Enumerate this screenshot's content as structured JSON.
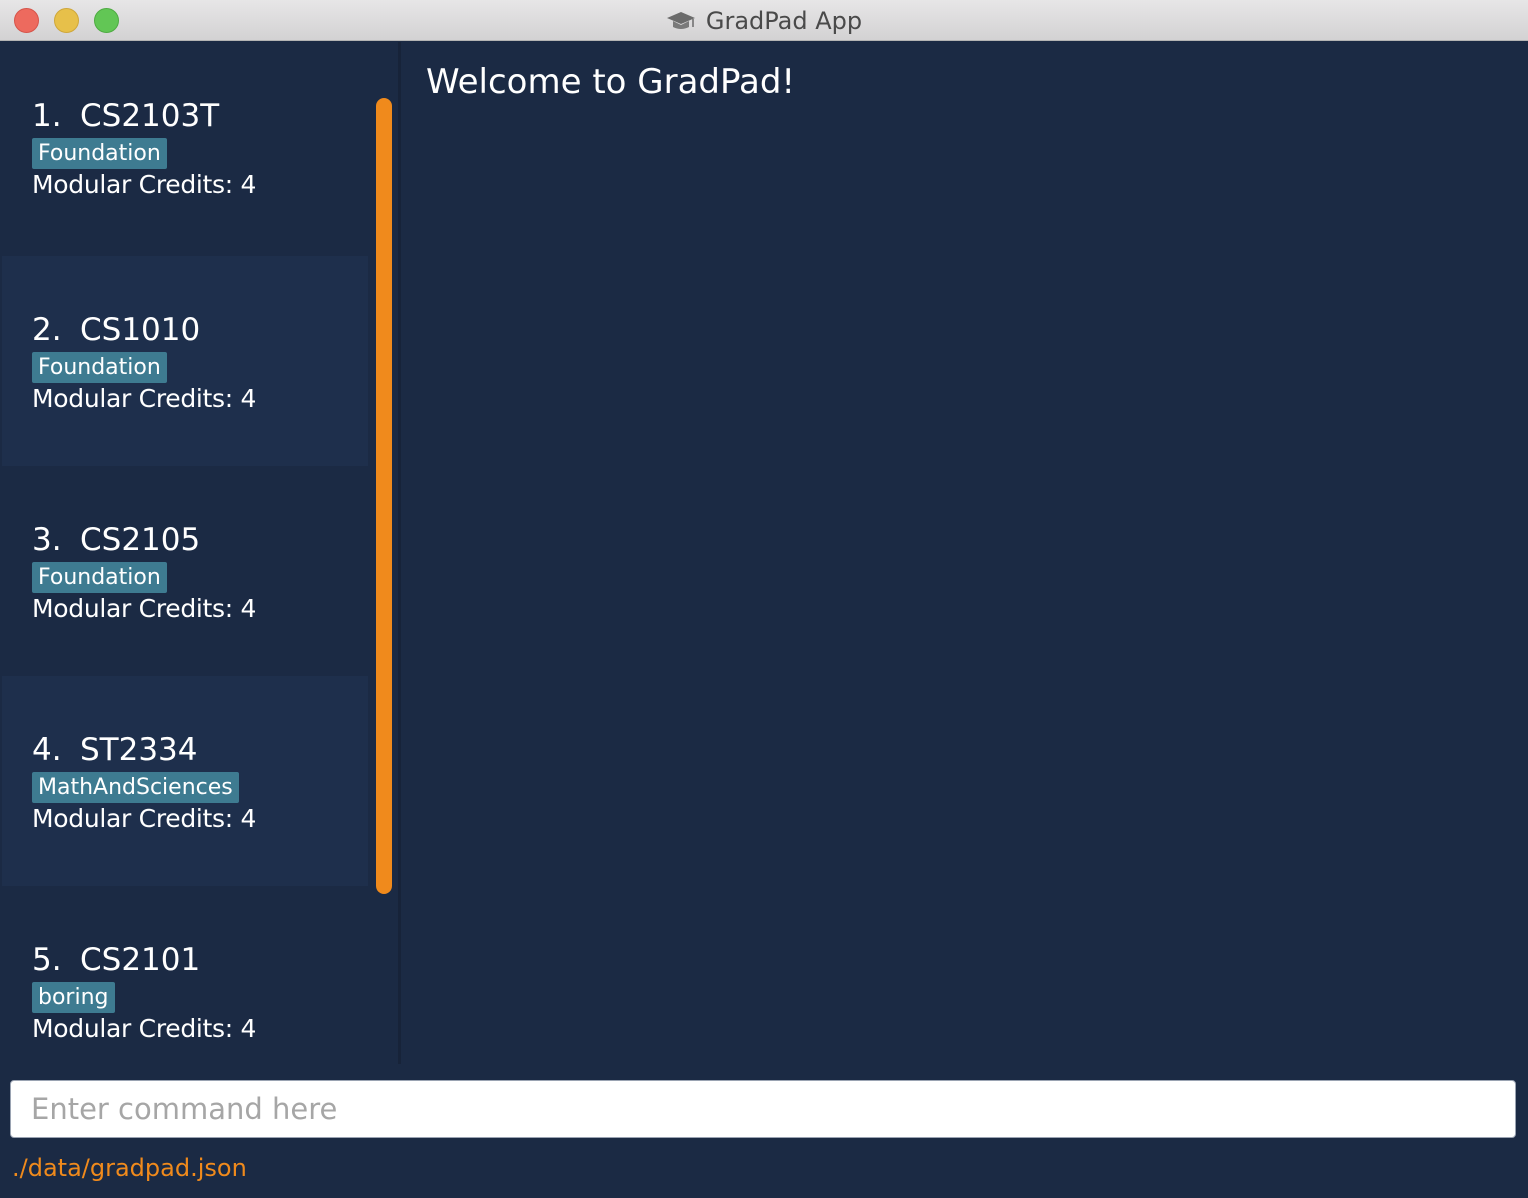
{
  "window": {
    "title": "GradPad App"
  },
  "modules": [
    {
      "index": "1.",
      "code": "CS2103T",
      "tag": "Foundation",
      "credits": "Modular Credits: 4"
    },
    {
      "index": "2.",
      "code": "CS1010",
      "tag": "Foundation",
      "credits": "Modular Credits: 4"
    },
    {
      "index": "3.",
      "code": "CS2105",
      "tag": "Foundation",
      "credits": "Modular Credits: 4"
    },
    {
      "index": "4.",
      "code": "ST2334",
      "tag": "MathAndSciences",
      "credits": "Modular Credits: 4"
    },
    {
      "index": "5.",
      "code": "CS2101",
      "tag": "boring",
      "credits": "Modular Credits: 4"
    }
  ],
  "result_display": {
    "text": "Welcome to GradPad!"
  },
  "command_box": {
    "value": "",
    "placeholder": "Enter command here"
  },
  "status_bar": {
    "save_location": "./data/gradpad.json"
  },
  "colors": {
    "background": "#1b2a44",
    "alt_row": "#1e2f4c",
    "tag": "#3e7b91",
    "accent": "#f08a1c"
  },
  "icons": {
    "title_icon": "graduation-cap-icon"
  }
}
